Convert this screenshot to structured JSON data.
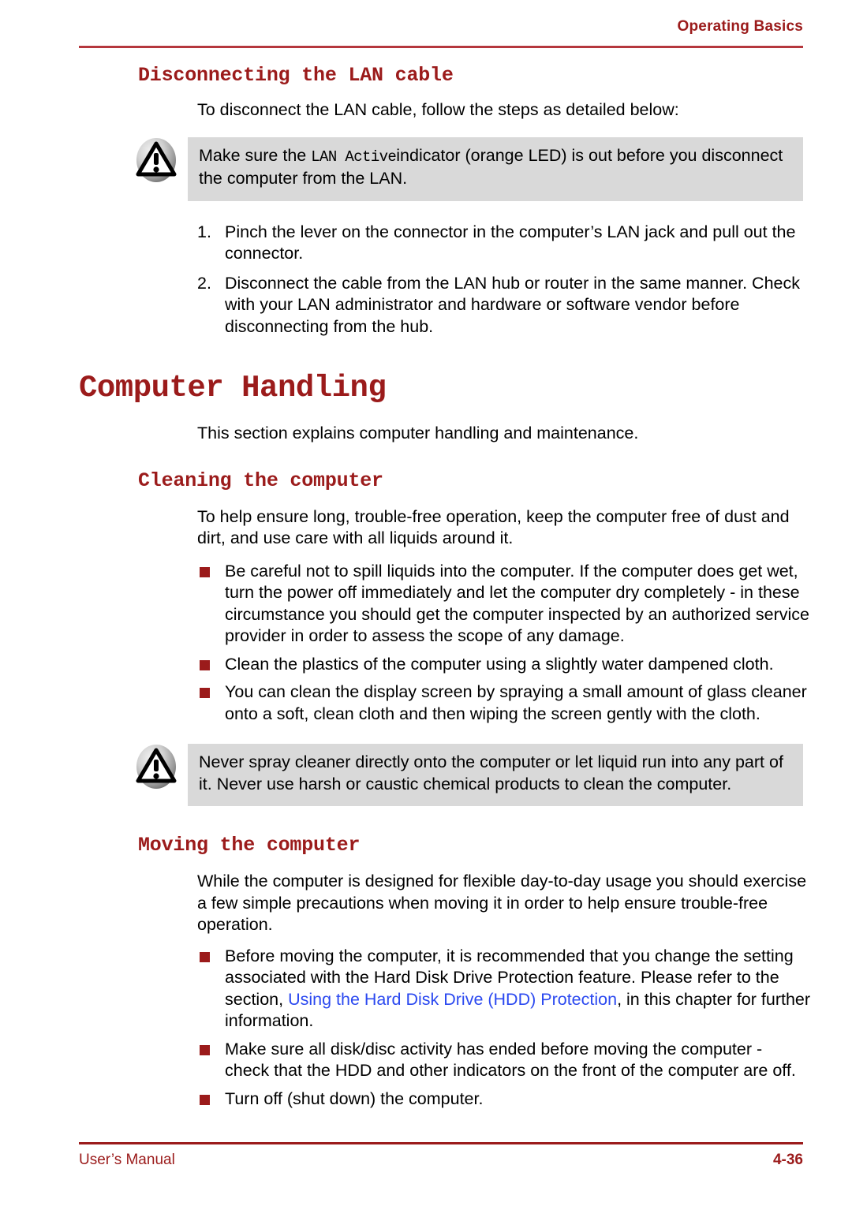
{
  "header": {
    "title": "Operating Basics",
    "rule_color": "#b5373d"
  },
  "colors": {
    "heading_red": "#9b1b1b",
    "bullet_red": "#9b1b1b",
    "link_blue": "#2b49f0",
    "caution_bg": "#d9d9d9"
  },
  "sections": {
    "disconnect_lan": {
      "heading": "Disconnecting the LAN cable",
      "intro": "To disconnect the LAN cable, follow the steps as detailed below:",
      "caution": {
        "icon": "warning-triangle-icon",
        "text_before": "Make sure the ",
        "mono": "LAN Active",
        "text_after": "indicator (orange LED) is out before you disconnect the computer from the LAN."
      },
      "steps": [
        {
          "marker": "1.",
          "text": "Pinch the lever on the connector in the computer’s LAN jack and pull out the connector."
        },
        {
          "marker": "2.",
          "text": "Disconnect the cable from the LAN hub or router in the same manner. Check with your LAN administrator and hardware or software vendor before disconnecting from the hub."
        }
      ]
    },
    "computer_handling": {
      "heading": "Computer Handling",
      "intro": "This section explains computer handling and maintenance."
    },
    "cleaning": {
      "heading": "Cleaning the computer",
      "intro": "To help ensure long, trouble-free operation, keep the computer free of dust and dirt, and use care with all liquids around it.",
      "bullets": [
        "Be careful not to spill liquids into the computer. If the computer does get wet, turn the power off immediately and let the computer dry completely - in these circumstance you should get the computer inspected by an authorized service provider in order to assess the scope of any damage.",
        "Clean the plastics of the computer using a slightly water dampened cloth.",
        "You can clean the display screen by spraying a small amount of glass cleaner onto a soft, clean cloth and then wiping the screen gently with the cloth."
      ],
      "caution": {
        "icon": "warning-triangle-icon",
        "text": "Never spray cleaner directly onto the computer or let liquid run into any part of it. Never use harsh or caustic chemical products to clean the computer."
      }
    },
    "moving": {
      "heading": "Moving the computer",
      "intro": "While the computer is designed for flexible day-to-day usage you should exercise a few simple precautions when moving it in order to help ensure trouble-free operation.",
      "bullets": [
        {
          "prefix": "Before moving the computer, it is recommended that you change the setting associated with the Hard Disk Drive Protection feature. Please refer to the section, ",
          "link": "Using the Hard Disk Drive (HDD) Protection",
          "suffix": ", in this chapter for further information."
        },
        {
          "text": "Make sure all disk/disc activity has ended before moving the computer - check that the HDD and other indicators on the front of the computer are off."
        },
        {
          "text": "Turn off (shut down) the computer."
        }
      ]
    }
  },
  "footer": {
    "left": "User’s Manual",
    "right": "4-36"
  }
}
